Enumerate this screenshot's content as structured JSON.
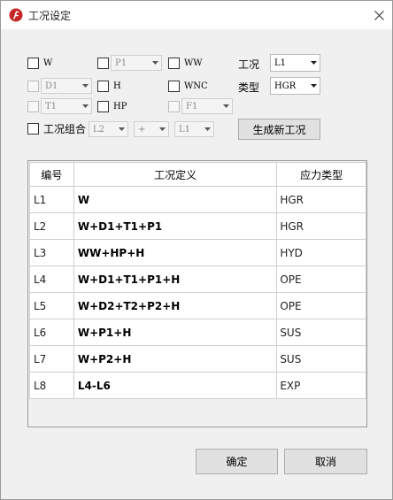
{
  "window": {
    "title": "工况设定",
    "close_symbol": "✕"
  },
  "checkboxes": {
    "w": {
      "label": "W",
      "enabled": true,
      "checked": false
    },
    "p_combo_enable": {
      "label": "",
      "enabled": true,
      "checked": false
    },
    "ww": {
      "label": "WW",
      "enabled": true,
      "checked": false
    },
    "d_combo_enable": {
      "label": "",
      "enabled": false,
      "checked": false
    },
    "h": {
      "label": "H",
      "enabled": true,
      "checked": false
    },
    "wnc": {
      "label": "WNC",
      "enabled": true,
      "checked": false
    },
    "t_combo_enable": {
      "label": "",
      "enabled": false,
      "checked": false
    },
    "hp": {
      "label": "HP",
      "enabled": true,
      "checked": false
    },
    "f_combo_enable": {
      "label": "",
      "enabled": false,
      "checked": false
    },
    "case_combination": {
      "label": "工况组合",
      "enabled": true,
      "checked": false
    }
  },
  "combos": {
    "p": {
      "value": "P1",
      "enabled": false
    },
    "d": {
      "value": "D1",
      "enabled": false
    },
    "t": {
      "value": "T1",
      "enabled": false
    },
    "f": {
      "value": "F1",
      "enabled": false
    },
    "combine_left": {
      "value": "L2",
      "enabled": false
    },
    "combine_operator": {
      "value": "+",
      "enabled": false
    },
    "combine_right": {
      "value": "L1",
      "enabled": false
    },
    "case": {
      "value": "L1",
      "enabled": true
    },
    "stress_type": {
      "value": "HGR",
      "enabled": true
    }
  },
  "labels": {
    "case": "工况",
    "type": "类型"
  },
  "buttons": {
    "generate": "生成新工况",
    "ok": "确定",
    "cancel": "取消"
  },
  "table": {
    "columns": [
      "编号",
      "工况定义",
      "应力类型"
    ],
    "rows": [
      [
        "L1",
        "W",
        "HGR"
      ],
      [
        "L2",
        "W+D1+T1+P1",
        "HGR"
      ],
      [
        "L3",
        "WW+HP+H",
        "HYD"
      ],
      [
        "L4",
        "W+D1+T1+P1+H",
        "OPE"
      ],
      [
        "L5",
        "W+D2+T2+P2+H",
        "OPE"
      ],
      [
        "L6",
        "W+P1+H",
        "SUS"
      ],
      [
        "L7",
        "W+P2+H",
        "SUS"
      ],
      [
        "L8",
        "L4-L6",
        "EXP"
      ]
    ]
  },
  "icons": {
    "app": "app-logo-icon",
    "close": "close-icon",
    "dropdown": "chevron-down-icon"
  },
  "colors": {
    "window_bg": "#f0f0f0",
    "titlebar_bg": "#ffffff",
    "app_icon": "#c62828"
  }
}
